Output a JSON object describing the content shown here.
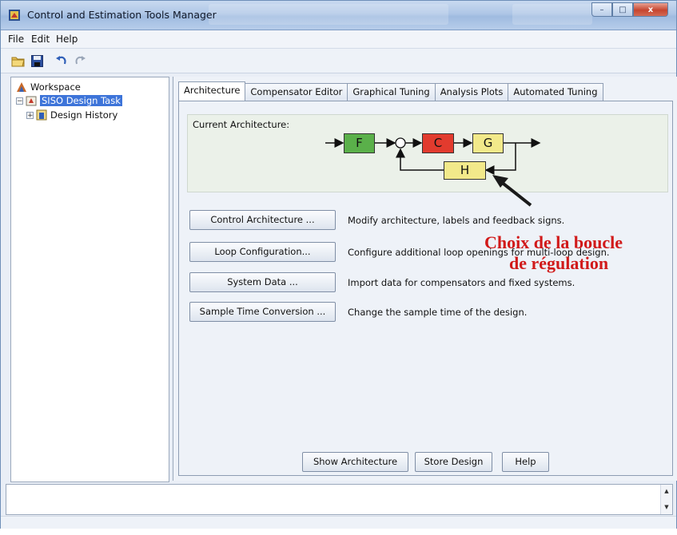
{
  "window": {
    "title": "Control and Estimation Tools Manager",
    "controls": {
      "minimize": "–",
      "maximize": "□",
      "close": "x"
    }
  },
  "menu": [
    "File",
    "Edit",
    "Help"
  ],
  "toolbar": {
    "icons": [
      "open-folder-icon",
      "save-icon",
      "undo-icon",
      "redo-icon"
    ]
  },
  "tree": {
    "root": "Workspace",
    "task": "SISO Design Task",
    "history": "Design History"
  },
  "tabs": [
    "Architecture",
    "Compensator Editor",
    "Graphical Tuning",
    "Analysis Plots",
    "Automated Tuning"
  ],
  "architecture": {
    "label": "Current Architecture:",
    "blocks": {
      "F": "F",
      "C": "C",
      "G": "G",
      "H": "H"
    },
    "colors": {
      "F": "#5ab04a",
      "C": "#e23b2e",
      "G": "#f2e98a",
      "H": "#f2e98a"
    }
  },
  "actions": [
    {
      "label": "Control Architecture ...",
      "desc": "Modify architecture, labels and feedback signs."
    },
    {
      "label": "Loop Configuration...",
      "desc": "Configure additional loop openings for multi-loop design."
    },
    {
      "label": "System Data ...",
      "desc": "Import data for compensators and fixed systems."
    },
    {
      "label": "Sample Time Conversion ...",
      "desc": "Change the sample time of the design."
    }
  ],
  "annotation": {
    "line1": "Choix de la boucle",
    "line2": "de régulation",
    "color": "#d11a1a"
  },
  "footer_buttons": [
    "Show Architecture",
    "Store Design",
    "Help"
  ]
}
